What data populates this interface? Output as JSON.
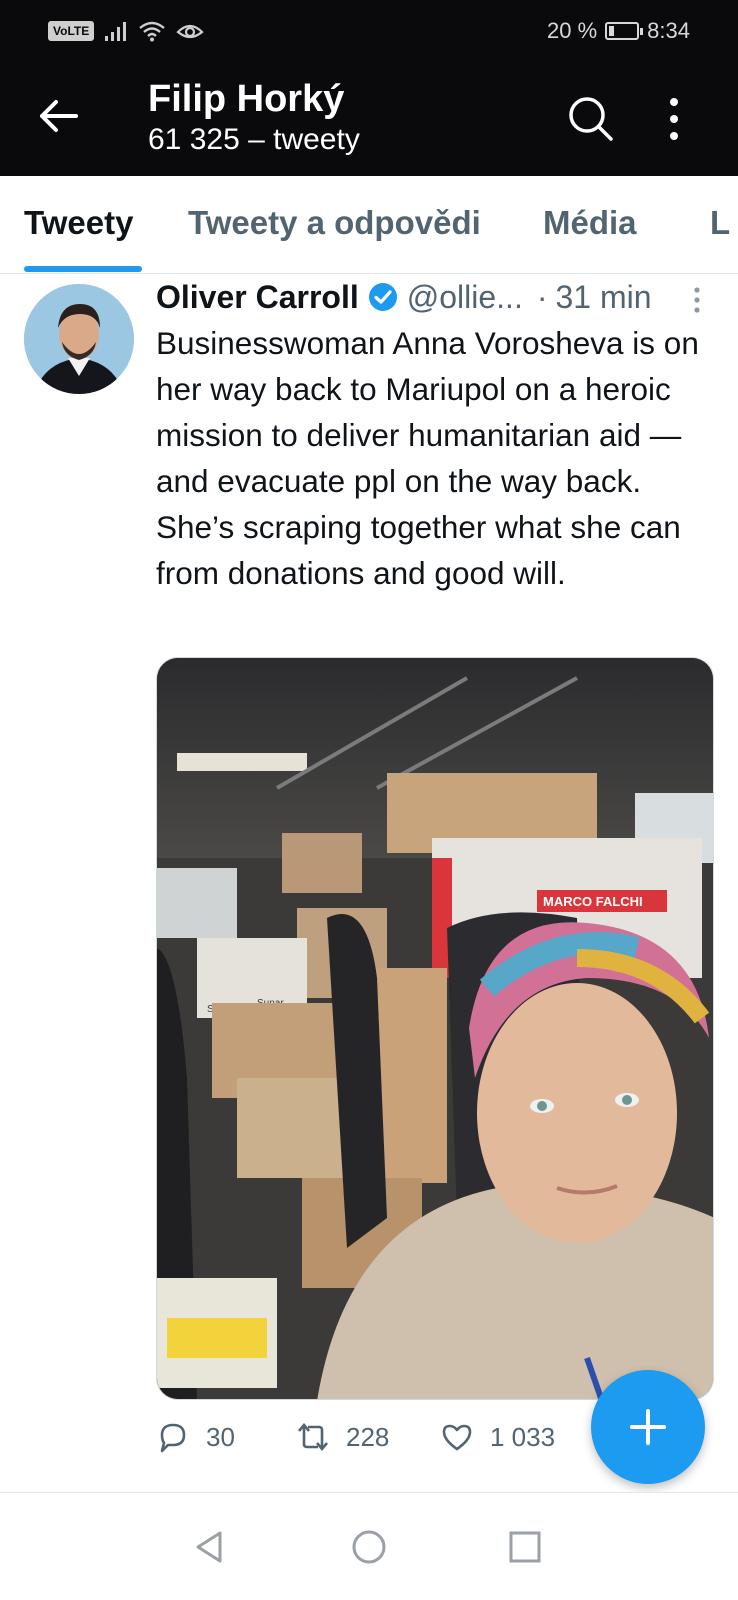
{
  "status_bar": {
    "network_badge": "VoLTE",
    "battery": "20 %",
    "battery_level": 0.2,
    "time": "8:34",
    "icons": [
      "signal-icon",
      "wifi-icon",
      "eye-icon",
      "battery-icon"
    ]
  },
  "header": {
    "title": "Filip Horký",
    "subtitle": "61 325 – tweety"
  },
  "tabs": [
    {
      "label": "Tweety",
      "active": true
    },
    {
      "label": "Tweety a odpovědi",
      "active": false
    },
    {
      "label": "Média",
      "active": false
    },
    {
      "label": "L",
      "active": false
    }
  ],
  "tweet": {
    "author": "Oliver Carroll",
    "handle": "@ollie...",
    "separator": "·",
    "time": "31 min",
    "text": "Businesswoman Anna Vorosheva is on her way back to Mariupol on a heroic mission to deliver humanitarian aid — and evacuate ppl on the way back. She’s scraping together what she can from donations and good will.",
    "box_labels": [
      "MARCO FALCHI",
      "Sunar",
      "Sunar"
    ],
    "stats": {
      "replies": "30",
      "retweets": "228",
      "likes": "1 033"
    }
  },
  "colors": {
    "accent": "#1d9bf0",
    "header_bg": "#0a0a0c",
    "secondary_text": "#536471"
  }
}
